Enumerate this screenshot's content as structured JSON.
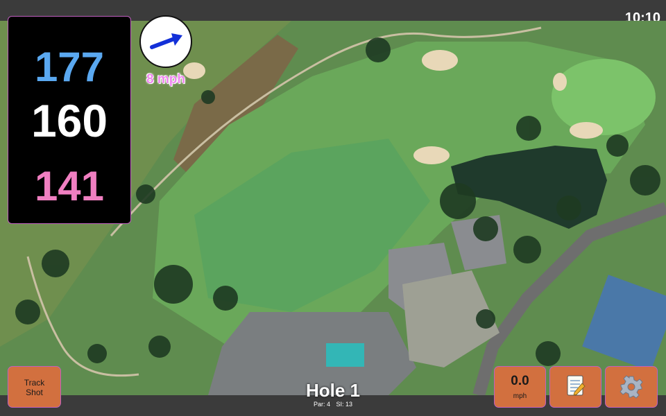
{
  "status_bar": {
    "time": "10:10"
  },
  "distances": {
    "back": "177",
    "middle": "160",
    "front": "141"
  },
  "wind": {
    "speed": "8 mph",
    "direction_icon": "arrow-icon"
  },
  "hole": {
    "title": "Hole 1",
    "par": "Par: 4",
    "si": "SI: 13"
  },
  "buttons": {
    "track_shot_line1": "Track",
    "track_shot_line2": "Shot",
    "speed_value": "0.0",
    "speed_unit": "mph",
    "notes_icon": "notepad-icon",
    "settings_icon": "gear-icon"
  },
  "colors": {
    "back_distance": "#5aa8f0",
    "middle_distance": "#ffffff",
    "front_distance": "#f07fc1",
    "button": "#d2703f",
    "accent_border": "#c060c0"
  }
}
